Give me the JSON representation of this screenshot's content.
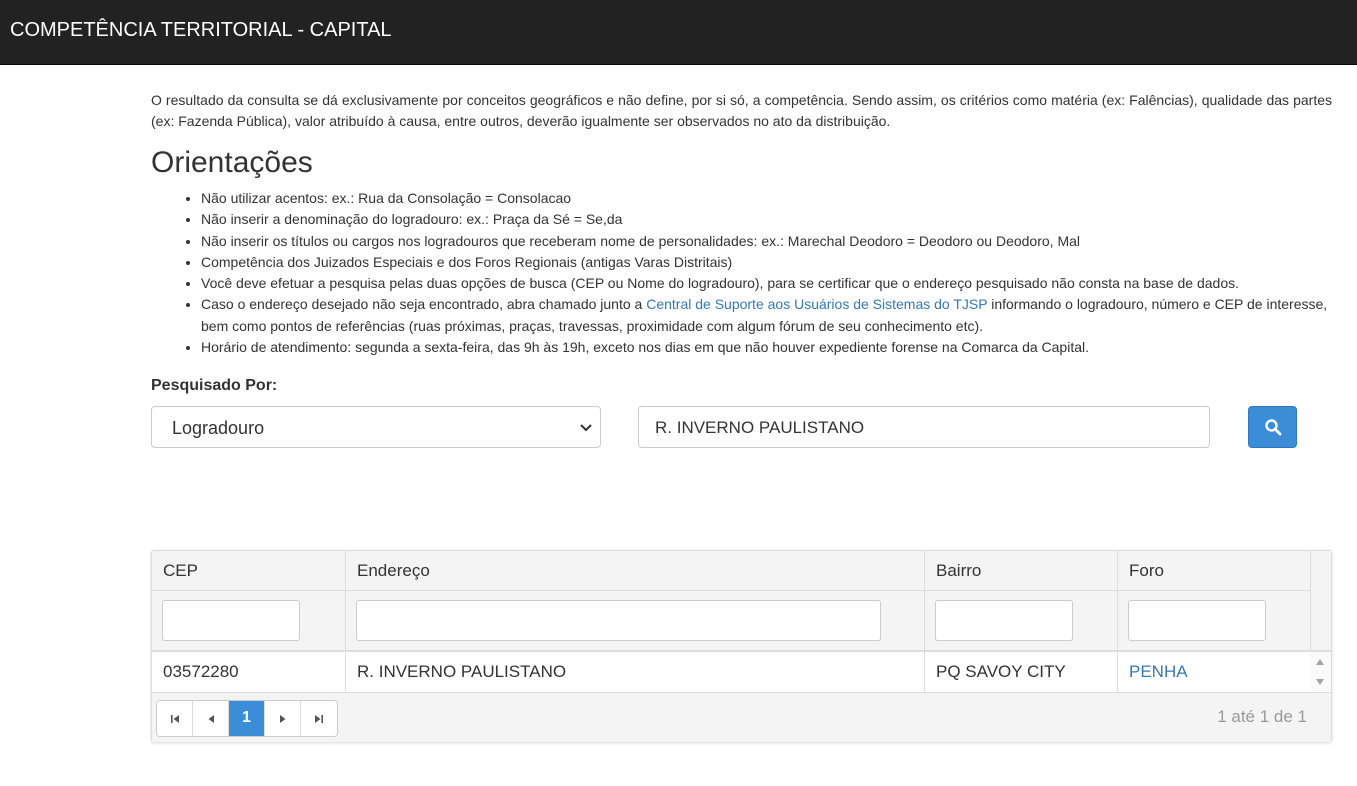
{
  "header": {
    "title": "COMPETÊNCIA TERRITORIAL - CAPITAL"
  },
  "disclaimer": "O resultado da consulta se dá exclusivamente por conceitos geográficos e não define, por si só, a competência. Sendo assim, os critérios como matéria (ex: Falências), qualidade das partes (ex: Fazenda Pública), valor atribuído à causa, entre outros, deverão igualmente ser observados no ato da distribuição.",
  "guidelines": {
    "heading": "Orientações",
    "items": [
      "Não utilizar acentos: ex.: Rua da Consolação = Consolacao",
      "Não inserir a denominação do logradouro: ex.: Praça da Sé = Se,da",
      "Não inserir os títulos ou cargos nos logradouros que receberam nome de personalidades: ex.: Marechal Deodoro = Deodoro ou Deodoro, Mal",
      "Competência dos Juizados Especiais e dos Foros Regionais (antigas Varas Distritais)",
      "Você deve efetuar a pesquisa pelas duas opções de busca (CEP ou Nome do logradouro), para se certificar que o endereço pesquisado não consta na base de dados."
    ],
    "support_item": {
      "before": "Caso o endereço desejado não seja encontrado, abra chamado junto a ",
      "link": "Central de Suporte aos Usuários de Sistemas do TJSP",
      "after": " informando o logradouro, número e CEP de interesse, bem como pontos de referências (ruas próximas, praças, travessas, proximidade com algum fórum de seu conhecimento etc)."
    },
    "hours_item": "Horário de atendimento: segunda a sexta-feira, das 9h às 19h, exceto nos dias em que não houver expediente forense na Comarca da Capital."
  },
  "search": {
    "label": "Pesquisado Por:",
    "type_selected": "Logradouro",
    "query": "R. INVERNO PAULISTANO",
    "button_icon": "search-icon",
    "button_color": "#3c8dd8"
  },
  "table": {
    "columns": [
      "CEP",
      "Endereço",
      "Bairro",
      "Foro"
    ],
    "rows": [
      {
        "cep": "03572280",
        "endereco": "R. INVERNO PAULISTANO",
        "bairro": "PQ SAVOY CITY",
        "foro": "PENHA"
      }
    ],
    "pagination": {
      "current_page": "1",
      "info": "1 até 1 de 1",
      "icons": [
        "first-page-icon",
        "prev-page-icon",
        "next-page-icon",
        "last-page-icon"
      ]
    }
  },
  "colors": {
    "topbar": "#222222",
    "link": "#337ab7",
    "accent": "#3c8dd8"
  }
}
